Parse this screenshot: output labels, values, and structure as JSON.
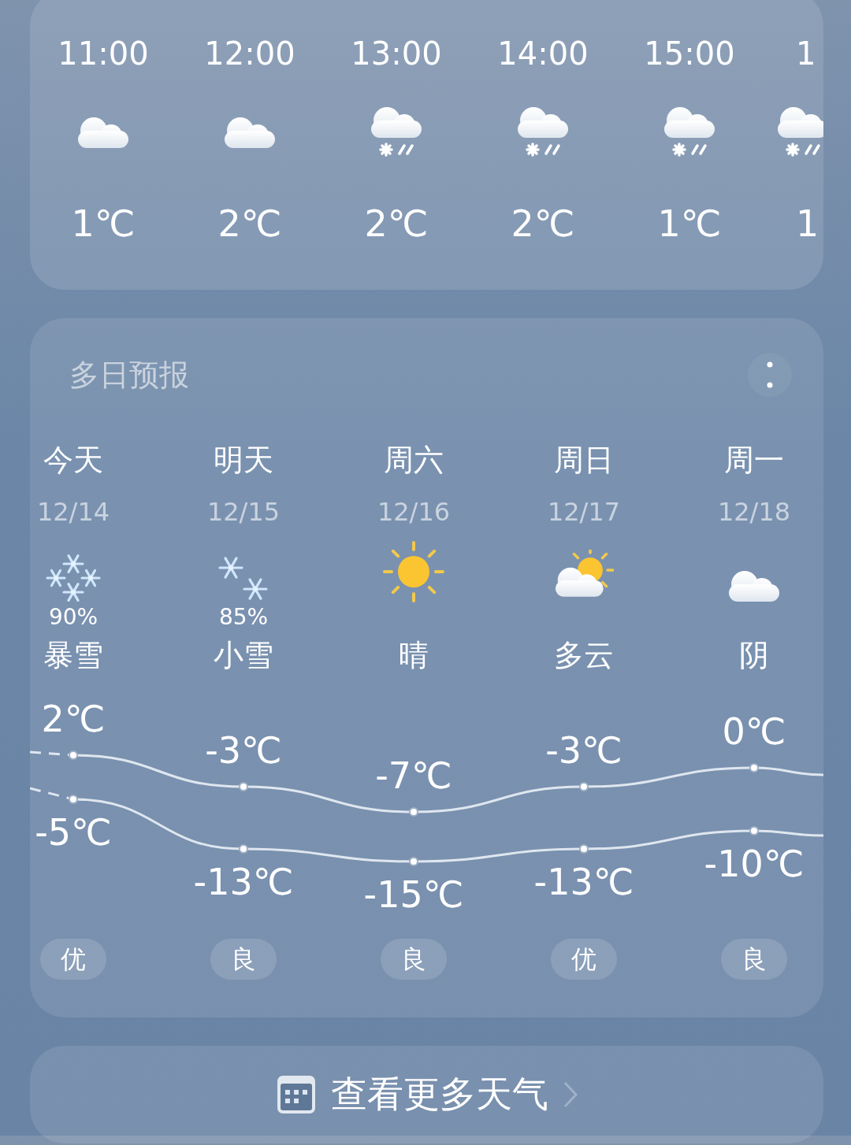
{
  "hourly": [
    {
      "time": "11:00",
      "kind": "cloudy",
      "temp": "1℃"
    },
    {
      "time": "12:00",
      "kind": "cloudy",
      "temp": "2℃"
    },
    {
      "time": "13:00",
      "kind": "snow_shower",
      "temp": "2℃"
    },
    {
      "time": "14:00",
      "kind": "snow_shower",
      "temp": "2℃"
    },
    {
      "time": "15:00",
      "kind": "snow_shower",
      "temp": "1℃"
    },
    {
      "time": "1",
      "kind": "snow_shower",
      "temp": "1"
    }
  ],
  "daily": {
    "title": "多日预报",
    "days": [
      {
        "day": "今天",
        "date": "12/14",
        "kind": "heavy_snow",
        "chance": "90%",
        "condition": "暴雪",
        "high": "2℃",
        "low": "-5℃",
        "aqi": "优"
      },
      {
        "day": "明天",
        "date": "12/15",
        "kind": "light_snow",
        "chance": "85%",
        "condition": "小雪",
        "high": "-3℃",
        "low": "-13℃",
        "aqi": "良"
      },
      {
        "day": "周六",
        "date": "12/16",
        "kind": "sunny",
        "condition": "晴",
        "high": "-7℃",
        "low": "-15℃",
        "aqi": "良"
      },
      {
        "day": "周日",
        "date": "12/17",
        "kind": "partly_cloudy",
        "condition": "多云",
        "high": "-3℃",
        "low": "-13℃",
        "aqi": "优"
      },
      {
        "day": "周一",
        "date": "12/18",
        "kind": "overcast",
        "condition": "阴",
        "high": "0℃",
        "low": "-10℃",
        "aqi": "良"
      }
    ]
  },
  "more_button": {
    "label": "查看更多天气"
  }
}
